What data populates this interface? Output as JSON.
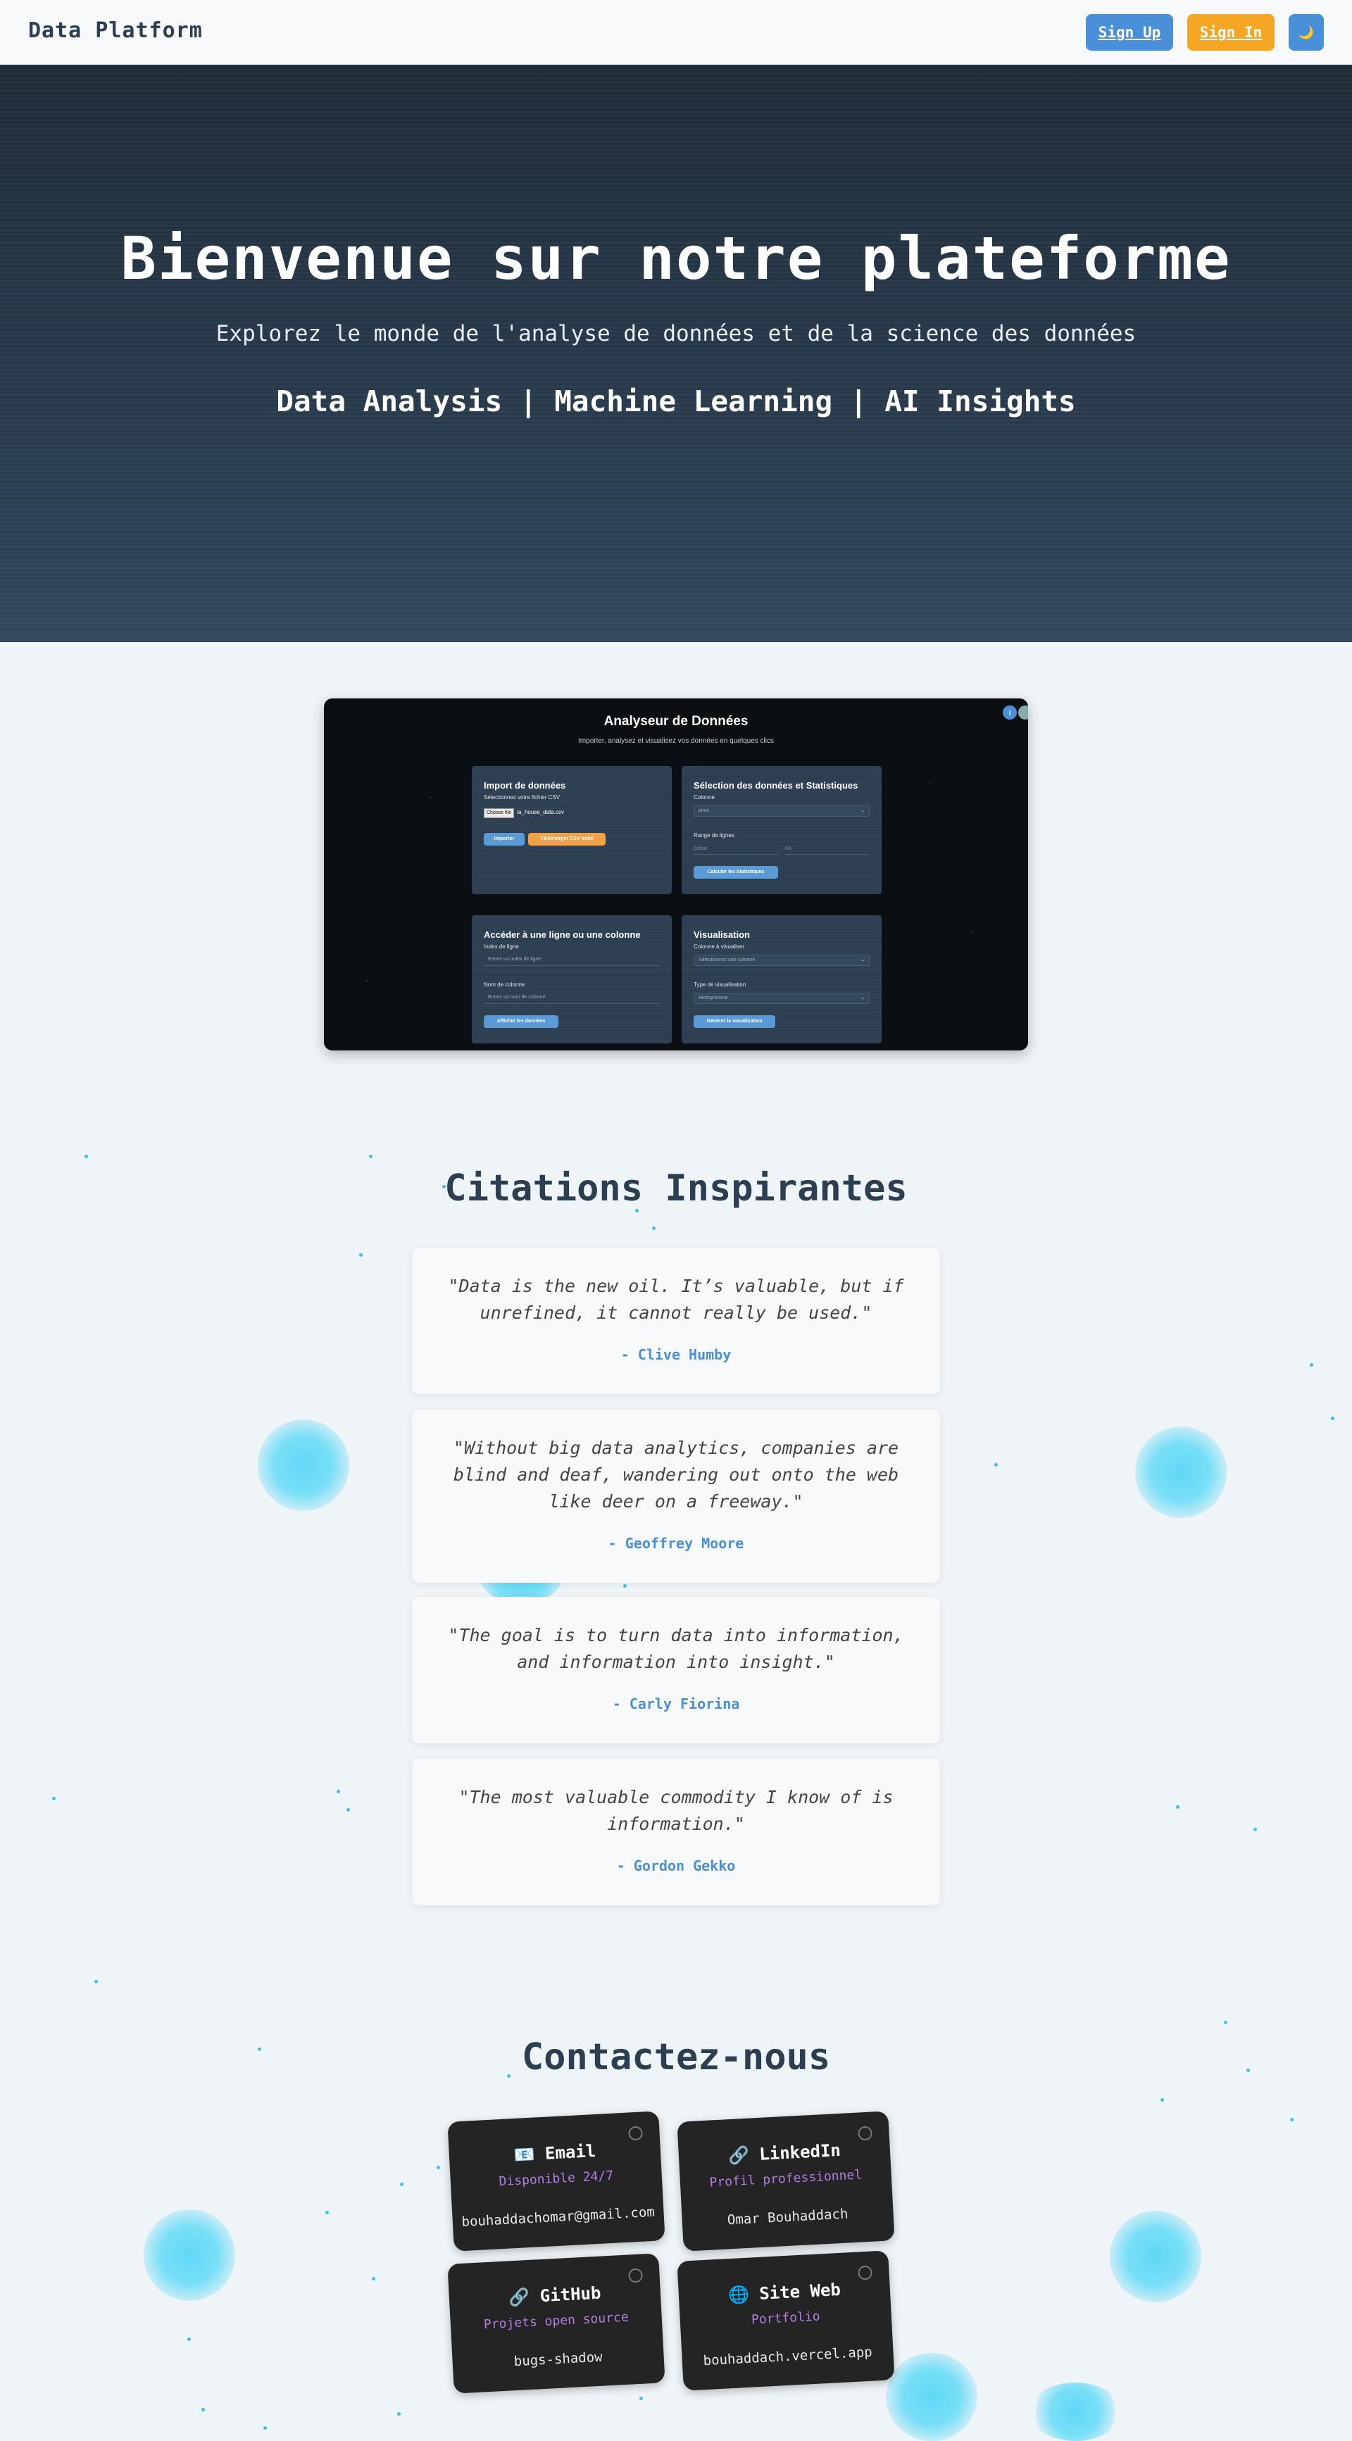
{
  "header": {
    "brand": "Data Platform",
    "signup_label": "Sign Up",
    "signin_label": "Sign In",
    "theme_icon": "moon-icon",
    "theme_glyph": "🌙"
  },
  "hero": {
    "title": "Bienvenue sur notre plateforme",
    "subtitle": "Explorez le monde de l'analyse de données et de la science des données",
    "tagline": "Data Analysis | Machine Learning | AI Insights"
  },
  "preview": {
    "title": "Analyseur de Données",
    "subtitle": "Importer, analysez et visualisez vos données en quelques clics",
    "info_glyph": "i",
    "import": {
      "title": "Import de données",
      "file_label": "Sélectionnez votre fichier CSV",
      "choose_label": "Choose file",
      "file_name": "la_house_data.csv",
      "import_button": "Importer",
      "download_button": "Télécharger CSV traité"
    },
    "selection": {
      "title": "Sélection des données et Statistiques",
      "column_label": "Colonne",
      "column_value": "price",
      "range_label": "Range de lignes",
      "range_start_placeholder": "Début",
      "range_end_placeholder": "Fin",
      "compute_button": "Calculer les Statistiques"
    },
    "access": {
      "title": "Accéder à une ligne ou une colonne",
      "row_label": "Index de ligne",
      "row_placeholder": "Entrez un index de ligne",
      "col_label": "Nom de colonne",
      "col_placeholder": "Entrez un nom de colonne",
      "show_button": "Afficher les données"
    },
    "visual": {
      "title": "Visualisation",
      "column_label": "Colonne à visualiser",
      "column_value": "Sélectionnez une colonne",
      "type_label": "Type de visualisation",
      "type_value": "Histogramme",
      "generate_button": "Générer la visualisation"
    }
  },
  "quotes": {
    "title": "Citations Inspirantes",
    "items": [
      {
        "text": "\"Data is the new oil. It’s valuable, but if unrefined, it cannot really be used.\"",
        "author": "- Clive Humby"
      },
      {
        "text": "\"Without big data analytics, companies are blind and deaf, wandering out onto the web like deer on a freeway.\"",
        "author": "- Geoffrey Moore"
      },
      {
        "text": "\"The goal is to turn data into information, and information into insight.\"",
        "author": "- Carly Fiorina"
      },
      {
        "text": "\"The most valuable commodity I know of is information.\"",
        "author": "- Gordon Gekko"
      }
    ]
  },
  "contact": {
    "title": "Contactez-nous",
    "cards": [
      {
        "icon": "email-icon",
        "glyph": "📧",
        "title": "Email",
        "sub": "Disponible 24/7",
        "value": "bouhaddachomar@gmail.com"
      },
      {
        "icon": "link-icon",
        "glyph": "🔗",
        "title": "LinkedIn",
        "sub": "Profil professionnel",
        "value": "Omar Bouhaddach"
      },
      {
        "icon": "link-icon",
        "glyph": "🔗",
        "title": "GitHub",
        "sub": "Projets open source",
        "value": "bugs-shadow"
      },
      {
        "icon": "globe-icon",
        "glyph": "🌐",
        "title": "Site Web",
        "sub": "Portfolio",
        "value": "bouhaddach.vercel.app"
      }
    ]
  },
  "colors": {
    "accent": "#4a90d9",
    "signin": "#f5a623",
    "hero_bg": "#2a3d50",
    "contact_card": "#242424",
    "contact_sub": "#b07fe0"
  }
}
